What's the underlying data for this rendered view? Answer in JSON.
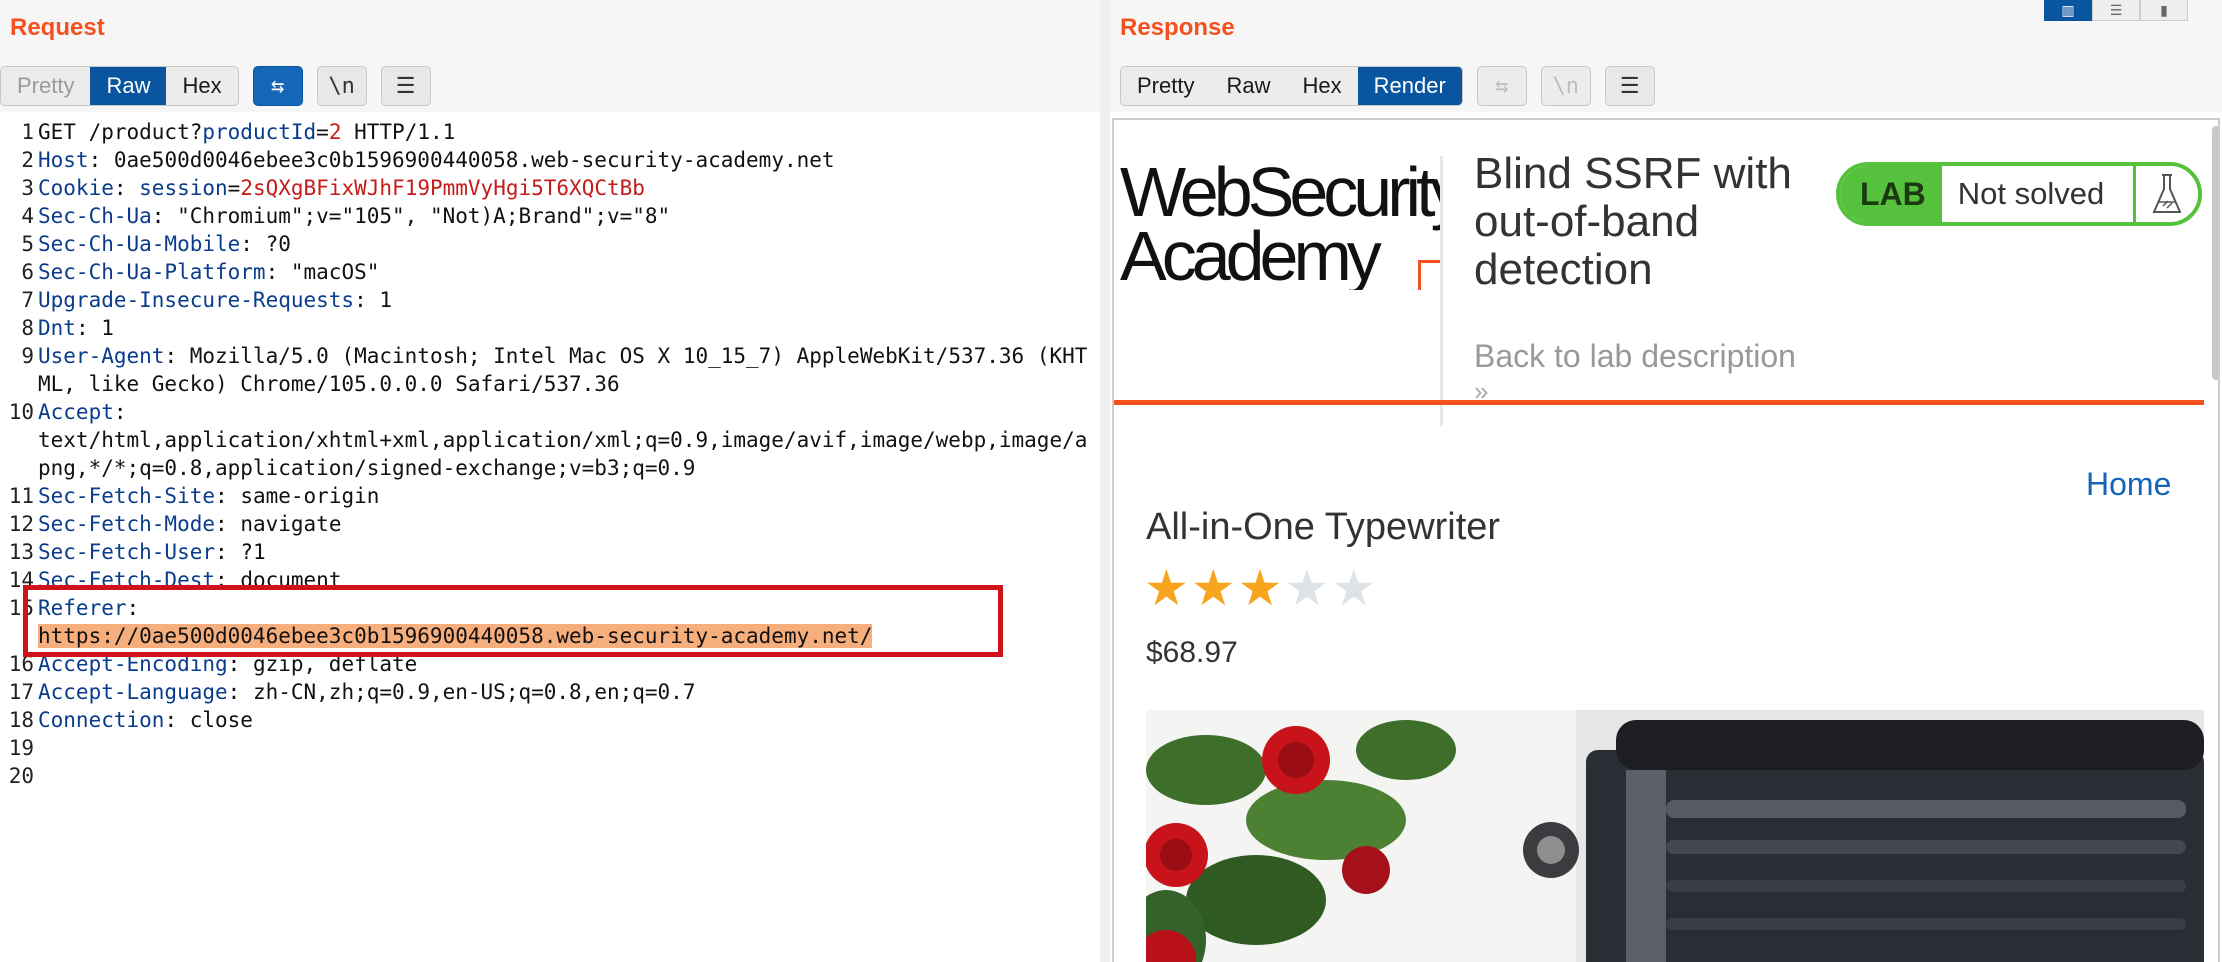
{
  "request": {
    "title": "Request",
    "tabs": [
      "Pretty",
      "Raw",
      "Hex"
    ],
    "tools": {
      "wrap": "⇆",
      "newline": "\\n",
      "menu": "☰"
    },
    "lines": [
      {
        "num": "1",
        "name": "",
        "sep": "",
        "text": "GET /product?",
        "pname": "productId",
        "peq": "=",
        "pval": "2",
        "tail": " HTTP/1.1"
      },
      {
        "num": "2",
        "name": "Host",
        "sep": ": ",
        "text": "0ae500d0046ebee3c0b1596900440058.web-security-academy.net"
      },
      {
        "num": "3",
        "name": "Cookie",
        "sep": ": ",
        "pname": "session",
        "peq": "=",
        "pval": "2sQXgBFixWJhF19PmmVyHgi5T6XQCtBb"
      },
      {
        "num": "4",
        "name": "Sec-Ch-Ua",
        "sep": ": ",
        "text": "\"Chromium\";v=\"105\", \"Not)A;Brand\";v=\"8\""
      },
      {
        "num": "5",
        "name": "Sec-Ch-Ua-Mobile",
        "sep": ": ",
        "text": "?0"
      },
      {
        "num": "6",
        "name": "Sec-Ch-Ua-Platform",
        "sep": ": ",
        "text": "\"macOS\""
      },
      {
        "num": "7",
        "name": "Upgrade-Insecure-Requests",
        "sep": ": ",
        "text": "1"
      },
      {
        "num": "8",
        "name": "Dnt",
        "sep": ": ",
        "text": "1"
      },
      {
        "num": "9",
        "name": "User-Agent",
        "sep": ": ",
        "text": "Mozilla/5.0 (Macintosh; Intel Mac OS X 10_15_7) AppleWebKit/537.36 (KHTML, like Gecko) Chrome/105.0.0.0 Safari/537.36"
      },
      {
        "num": "10",
        "name": "Accept",
        "sep": ":",
        "text": "\ntext/html,application/xhtml+xml,application/xml;q=0.9,image/avif,image/webp,image/apng,*/*;q=0.8,application/signed-exchange;v=b3;q=0.9"
      },
      {
        "num": "11",
        "name": "Sec-Fetch-Site",
        "sep": ": ",
        "text": "same-origin"
      },
      {
        "num": "12",
        "name": "Sec-Fetch-Mode",
        "sep": ": ",
        "text": "navigate"
      },
      {
        "num": "13",
        "name": "Sec-Fetch-User",
        "sep": ": ",
        "text": "?1"
      },
      {
        "num": "14",
        "name": "Sec-Fetch-Dest",
        "sep": ": ",
        "text": "document"
      },
      {
        "num": "15",
        "name": "Referer",
        "sep": ":",
        "text": "",
        "highlight": "https://0ae500d0046ebee3c0b1596900440058.web-security-academy.net/"
      },
      {
        "num": "16",
        "name": "Accept-Encoding",
        "sep": ": ",
        "text": "gzip, deflate"
      },
      {
        "num": "17",
        "name": "Accept-Language",
        "sep": ": ",
        "text": "zh-CN,zh;q=0.9,en-US;q=0.8,en;q=0.7"
      },
      {
        "num": "18",
        "name": "Connection",
        "sep": ": ",
        "text": "close"
      },
      {
        "num": "19",
        "name": "",
        "sep": "",
        "text": ""
      },
      {
        "num": "20",
        "name": "",
        "sep": "",
        "text": ""
      }
    ]
  },
  "response": {
    "title": "Response",
    "tabs": [
      "Pretty",
      "Raw",
      "Hex",
      "Render"
    ],
    "tools": {
      "wrap": "⇆",
      "newline": "\\n",
      "menu": "☰"
    }
  },
  "render": {
    "logo_line1": "WebSecurity",
    "logo_line2": "Academy",
    "lab_title": "Blind SSRF with out-of-band detection",
    "back_link": "Back to lab description",
    "back_chevron": "»",
    "lab_label": "LAB",
    "lab_status": "Not solved",
    "home": "Home",
    "product_name": "All-in-One Typewriter",
    "rating": 3,
    "rating_max": 5,
    "price": "$68.97"
  },
  "colors": {
    "accent": "#f4511e",
    "active_tab": "#0a55a0",
    "lab_green": "#56c13d",
    "highlight_border": "#d0121b",
    "highlight_fill": "#f6ae7d",
    "header_name": "#0a3c8c",
    "param_value": "#c41b1b",
    "link": "#1465b7",
    "star": "#f7a51e"
  }
}
